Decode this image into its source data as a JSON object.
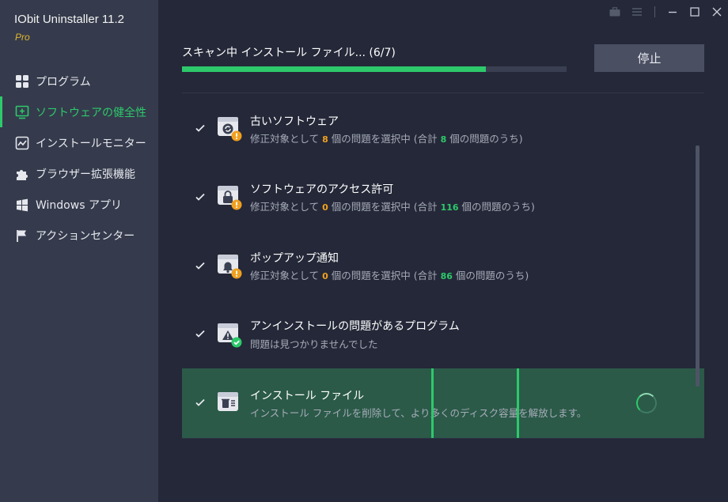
{
  "app": {
    "title": "IObit Uninstaller 11.2",
    "edition": "Pro"
  },
  "sidebar": {
    "items": [
      {
        "label": "プログラム",
        "icon": "grid-icon",
        "active": false
      },
      {
        "label": "ソフトウェアの健全性",
        "icon": "software-health-icon",
        "active": true
      },
      {
        "label": "インストールモニター",
        "icon": "monitor-chart-icon",
        "active": false
      },
      {
        "label": "ブラウザー拡張機能",
        "icon": "puzzle-icon",
        "active": false
      },
      {
        "label": "Windows アプリ",
        "icon": "windows-icon",
        "active": false
      },
      {
        "label": "アクションセンター",
        "icon": "flag-icon",
        "active": false
      }
    ]
  },
  "window_controls": [
    "briefcase-icon",
    "menu-icon",
    "minimize-icon",
    "maximize-icon",
    "close-icon"
  ],
  "scan": {
    "status": "スキャン中 インストール ファイル... (6/7)",
    "progress": 0.79,
    "stop_label": "停止"
  },
  "items": [
    {
      "title": "古いソフトウェア",
      "desc": {
        "pre": "修正対象として ",
        "n1": "8",
        "mid": " 個の問題を選択中 (合計 ",
        "n2": "8",
        "post": " 個の問題のうち)"
      },
      "icon": "outdated-software-icon",
      "badge": "warning-badge-icon",
      "checked": true
    },
    {
      "title": "ソフトウェアのアクセス許可",
      "desc": {
        "pre": "修正対象として ",
        "n1": "0",
        "mid": " 個の問題を選択中 (合計 ",
        "n2": "116",
        "post": " 個の問題のうち)"
      },
      "icon": "access-lock-icon",
      "badge": "warning-badge-icon",
      "checked": true
    },
    {
      "title": "ポップアップ通知",
      "desc": {
        "pre": "修正対象として ",
        "n1": "0",
        "mid": " 個の問題を選択中 (合計 ",
        "n2": "86",
        "post": " 個の問題のうち)"
      },
      "icon": "popup-bell-icon",
      "badge": "warning-badge-icon",
      "checked": true
    },
    {
      "title": "アンインストールの問題があるプログラム",
      "desc_text": "問題は見つかりませんでした",
      "icon": "uninstall-warning-icon",
      "badge": "ok-badge-icon",
      "checked": true
    },
    {
      "title": "インストール ファイル",
      "desc_text": "インストール ファイルを削除して、より多くのディスク容量を解放します。",
      "icon": "install-files-trash-icon",
      "checked": true,
      "scanning": true
    }
  ],
  "colors": {
    "accent": "#2dc96b",
    "warning": "#f0a020",
    "edition": "#e0b52e"
  }
}
